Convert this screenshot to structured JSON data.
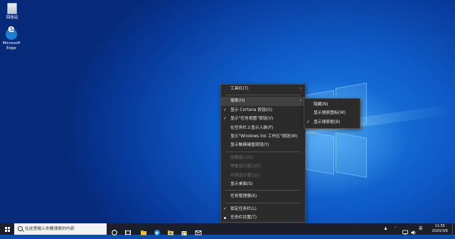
{
  "desktop": {
    "icons": [
      {
        "label": "回收站",
        "icon": "recycle-bin-icon"
      },
      {
        "label": "Microsoft Edge",
        "icon": "edge-icon"
      }
    ]
  },
  "context_menu": {
    "items": [
      {
        "label": "工具栏(T)",
        "submenu": true
      },
      {
        "label": "搜索(H)",
        "submenu": true,
        "highlighted": true
      },
      {
        "label": "显示 Cortana 按钮(O)",
        "checked": true
      },
      {
        "label": "显示\"任务视图\"按钮(V)",
        "checked": true
      },
      {
        "label": "在任务栏上显示人脉(P)"
      },
      {
        "label": "显示\"Windows Ink 工作区\"按钮(W)"
      },
      {
        "label": "显示触摸键盘按钮(Y)"
      },
      {
        "label": "层叠窗口(D)",
        "disabled": true
      },
      {
        "label": "堆叠显示窗口(E)",
        "disabled": true
      },
      {
        "label": "并排显示窗口(I)",
        "disabled": true
      },
      {
        "label": "显示桌面(S)"
      },
      {
        "label": "任务管理器(K)"
      },
      {
        "label": "锁定任务栏(L)",
        "checked": true
      },
      {
        "label": "任务栏设置(T)",
        "gear": true
      }
    ]
  },
  "search_submenu": {
    "items": [
      {
        "label": "隐藏(N)"
      },
      {
        "label": "显示搜索图标(W)"
      },
      {
        "label": "显示搜索框(B)",
        "checked": true
      }
    ]
  },
  "taskbar": {
    "search_placeholder": "在这里输入你要搜索的内容",
    "ime_label": "英",
    "time": "11:55",
    "date": "2020/3/6",
    "pinned_icons": [
      "cortana-icon",
      "task-view-icon",
      "file-explorer-icon",
      "edge-icon",
      "folder-icon",
      "store-icon",
      "mail-icon"
    ]
  },
  "colors": {
    "menu_bg": "#2b2b2b",
    "menu_text": "#e6e6e6",
    "accent": "#0a78d7",
    "taskbar_bg": "#1b1f2a"
  }
}
